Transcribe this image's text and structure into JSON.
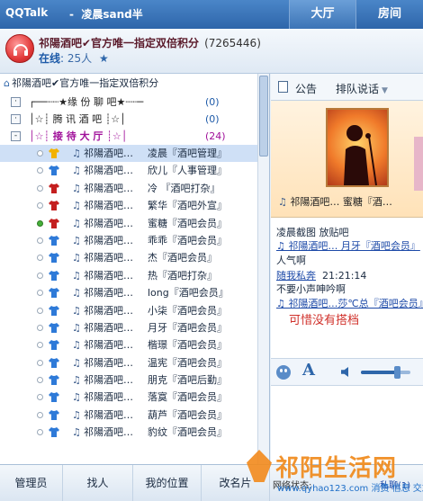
{
  "titlebar": {
    "app": "QQTalk",
    "separator": "-",
    "room": "凌晨sand半",
    "tabs": [
      "大厅",
      "房间"
    ]
  },
  "header": {
    "room_name": "祁陽酒吧✔官方唯一指定双倍积分",
    "room_id": "(7265446)",
    "online_label": "在线",
    "online_count": "25人",
    "star": "★"
  },
  "breadcrumb": "祁陽酒吧✔官方唯一指定双倍积分",
  "groups": [
    {
      "toggle": "·",
      "name": "┌──┈┈★缘 份 聊 吧★┈┈─",
      "count": "(0)"
    },
    {
      "toggle": "·",
      "name": "│☆┊     腾 讯 酒 吧     ┊☆│",
      "count": "(0)"
    },
    {
      "toggle": "-",
      "name": "│☆┊     接 待 大 厅     ┊☆│",
      "count": "(24)"
    }
  ],
  "users": [
    {
      "online": false,
      "shirt": "#f2b200",
      "note": "♫",
      "name": "祁陽酒吧…",
      "role": "凌晨『酒吧管理』",
      "selected": true
    },
    {
      "online": false,
      "shirt": "#2e7ad8",
      "note": "♫",
      "name": "祁陽酒吧…",
      "role": "欣儿『人事管理』",
      "selected": false
    },
    {
      "online": false,
      "shirt": "#c41f1f",
      "note": "♫",
      "name": "祁陽酒吧…",
      "role": "冷 『酒吧打杂』",
      "selected": false
    },
    {
      "online": false,
      "shirt": "#c41f1f",
      "note": "♫",
      "name": "祁陽酒吧…",
      "role": "繁华『酒吧外宣』",
      "selected": false
    },
    {
      "online": true,
      "shirt": "#c41f1f",
      "note": "♫",
      "name": "祁陽酒吧…",
      "role": "蜜糖『酒吧会员』",
      "selected": false
    },
    {
      "online": false,
      "shirt": "#2e7ad8",
      "note": "♫",
      "name": "祁陽酒吧…",
      "role": "乖乖『酒吧会员』",
      "selected": false
    },
    {
      "online": false,
      "shirt": "#2e7ad8",
      "note": "♫",
      "name": "祁陽酒吧…",
      "role": "杰『酒吧会员』",
      "selected": false
    },
    {
      "online": false,
      "shirt": "#2e7ad8",
      "note": "♫",
      "name": "祁陽酒吧…",
      "role": "热『酒吧打杂』",
      "selected": false
    },
    {
      "online": false,
      "shirt": "#2e7ad8",
      "note": "♫",
      "name": "祁陽酒吧…",
      "role": "long『酒吧会员』",
      "selected": false
    },
    {
      "online": false,
      "shirt": "#2e7ad8",
      "note": "♫",
      "name": "祁陽酒吧…",
      "role": "小柒『酒吧会员』",
      "selected": false
    },
    {
      "online": false,
      "shirt": "#2e7ad8",
      "note": "♫",
      "name": "祁陽酒吧…",
      "role": "月牙『酒吧会员』",
      "selected": false
    },
    {
      "online": false,
      "shirt": "#2e7ad8",
      "note": "♫",
      "name": "祁陽酒吧…",
      "role": "楷璟『酒吧会员』",
      "selected": false
    },
    {
      "online": false,
      "shirt": "#2e7ad8",
      "note": "♫",
      "name": "祁陽酒吧…",
      "role": "温宪『酒吧会员』",
      "selected": false
    },
    {
      "online": false,
      "shirt": "#2e7ad8",
      "note": "♫",
      "name": "祁陽酒吧…",
      "role": "朋克『酒吧后勤』",
      "selected": false
    },
    {
      "online": false,
      "shirt": "#2e7ad8",
      "note": "♫",
      "name": "祁陽酒吧…",
      "role": "落寞『酒吧会员』",
      "selected": false
    },
    {
      "online": false,
      "shirt": "#2e7ad8",
      "note": "♫",
      "name": "祁陽酒吧…",
      "role": "葫芦『酒吧会员』",
      "selected": false
    },
    {
      "online": false,
      "shirt": "#2e7ad8",
      "note": "♫",
      "name": "祁陽酒吧…",
      "role": "豹纹『酒吧会员』",
      "selected": false
    }
  ],
  "right": {
    "notice_tab": "公告",
    "mode_tab": "排队说话",
    "showcase_caption_note": "♫",
    "showcase_caption": "祁陽酒吧…   蜜糖『酒…",
    "chat": [
      {
        "kind": "txt",
        "text": "凌晨截图  放贴吧"
      },
      {
        "kind": "link",
        "text": "♫ 祁陽酒吧…    月牙『酒吧会员』"
      },
      {
        "kind": "txt",
        "text": "   人气啊"
      },
      {
        "kind": "link2",
        "text": "随我私奔",
        "time": "21:21:14"
      },
      {
        "kind": "txt",
        "text": "   不要小声呻吟啊"
      },
      {
        "kind": "link",
        "text": "♫ 祁陽酒吧…莎℃总『酒吧会员』"
      },
      {
        "kind": "red",
        "text": "可惜没有搭档"
      }
    ],
    "volume": 0.72
  },
  "bottom": {
    "buttons": [
      "管理员",
      "找人",
      "我的位置",
      "改名片"
    ],
    "net_state": "网络状态:",
    "priv_chat": "私聊(1)"
  },
  "watermark": {
    "brand": "祁阳生活网",
    "site": "www.qyhao123.com 消费 信息 交友"
  }
}
